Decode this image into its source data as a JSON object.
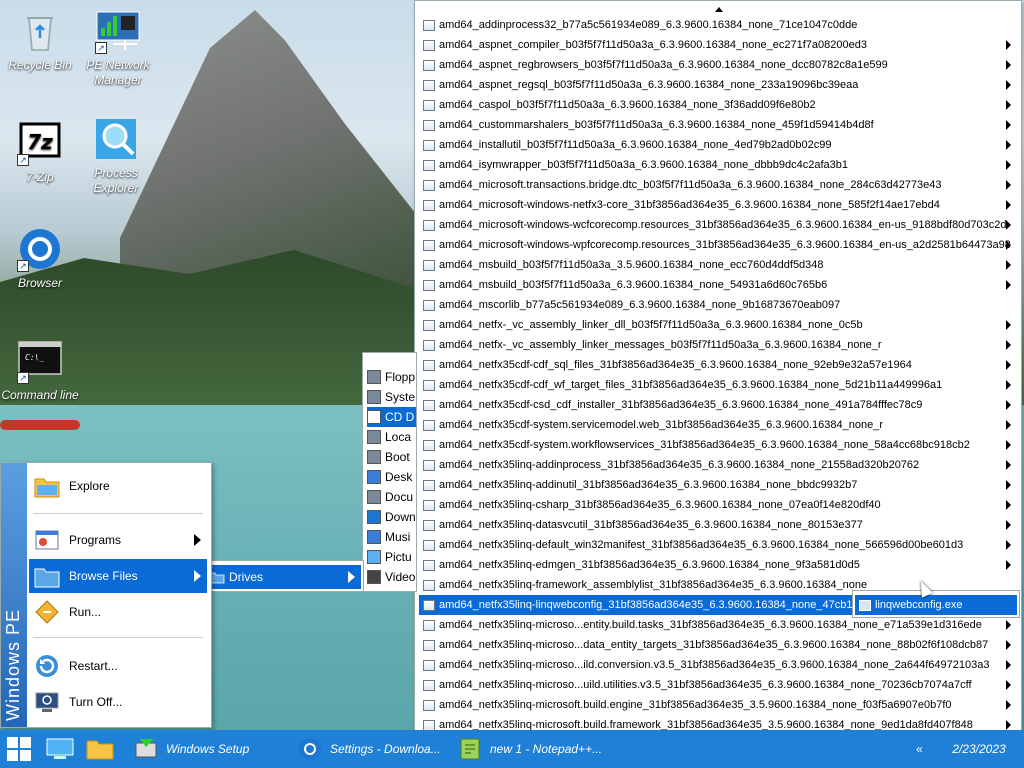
{
  "desktop": {
    "icons": [
      {
        "label": "Recycle Bin",
        "icon": "recycle-bin-icon"
      },
      {
        "label": "PE Network Manager",
        "icon": "network-manager-icon"
      },
      {
        "label": "7-Zip",
        "icon": "7zip-icon"
      },
      {
        "label": "Process Explorer",
        "icon": "process-explorer-icon"
      },
      {
        "label": "Browser",
        "icon": "browser-icon"
      },
      {
        "label": "Command line",
        "icon": "command-line-icon"
      }
    ]
  },
  "taskbar": {
    "buttons": [
      {
        "label": "Windows Setup"
      },
      {
        "label": "Settings - Downloa..."
      },
      {
        "label": "new 1 - Notepad++..."
      }
    ],
    "clock": "2/23/2023"
  },
  "start_menu": {
    "brand": "Windows PE",
    "items": [
      {
        "label": "Explore"
      },
      {
        "label": "Programs"
      },
      {
        "label": "Browse Files"
      },
      {
        "label": "Run..."
      },
      {
        "label": "Restart..."
      },
      {
        "label": "Turn Off..."
      }
    ]
  },
  "drives_menu": {
    "item": "Drives"
  },
  "drive_list": {
    "items": [
      "Flopp",
      "Syste",
      "CD D",
      "Loca",
      "Boot",
      "Desk",
      "Docu",
      "Down",
      "Musi",
      "Pictu",
      "Video"
    ]
  },
  "folder_list": {
    "rows": [
      "amd64_addinprocess32_b77a5c561934e089_6.3.9600.16384_none_71ce1047c0dde",
      "amd64_aspnet_compiler_b03f5f7f11d50a3a_6.3.9600.16384_none_ec271f7a08200ed3",
      "amd64_aspnet_regbrowsers_b03f5f7f11d50a3a_6.3.9600.16384_none_dcc80782c8a1e599",
      "amd64_aspnet_regsql_b03f5f7f11d50a3a_6.3.9600.16384_none_233a19096bc39eaa",
      "amd64_caspol_b03f5f7f11d50a3a_6.3.9600.16384_none_3f36add09f6e80b2",
      "amd64_custommarshalers_b03f5f7f11d50a3a_6.3.9600.16384_none_459f1d59414b4d8f",
      "amd64_installutil_b03f5f7f11d50a3a_6.3.9600.16384_none_4ed79b2ad0b02c99",
      "amd64_isymwrapper_b03f5f7f11d50a3a_6.3.9600.16384_none_dbbb9dc4c2afa3b1",
      "amd64_microsoft.transactions.bridge.dtc_b03f5f7f11d50a3a_6.3.9600.16384_none_284c63d42773e43",
      "amd64_microsoft-windows-netfx3-core_31bf3856ad364e35_6.3.9600.16384_none_585f2f14ae17ebd4",
      "amd64_microsoft-windows-wcfcorecomp.resources_31bf3856ad364e35_6.3.9600.16384_en-us_9188bdf80d703c2d",
      "amd64_microsoft-windows-wpfcorecomp.resources_31bf3856ad364e35_6.3.9600.16384_en-us_a2d2581b64473a98",
      "amd64_msbuild_b03f5f7f11d50a3a_3.5.9600.16384_none_ecc760d4ddf5d348",
      "amd64_msbuild_b03f5f7f11d50a3a_6.3.9600.16384_none_54931a6d60c765b6",
      "amd64_mscorlib_b77a5c561934e089_6.3.9600.16384_none_9b16873670eab097",
      "amd64_netfx-_vc_assembly_linker_dll_b03f5f7f11d50a3a_6.3.9600.16384_none_0c5b",
      "amd64_netfx-_vc_assembly_linker_messages_b03f5f7f11d50a3a_6.3.9600.16384_none_r",
      "amd64_netfx35cdf-cdf_sql_files_31bf3856ad364e35_6.3.9600.16384_none_92eb9e32a57e1964",
      "amd64_netfx35cdf-cdf_wf_target_files_31bf3856ad364e35_6.3.9600.16384_none_5d21b11a449996a1",
      "amd64_netfx35cdf-csd_cdf_installer_31bf3856ad364e35_6.3.9600.16384_none_491a784fffec78c9",
      "amd64_netfx35cdf-system.servicemodel.web_31bf3856ad364e35_6.3.9600.16384_none_r",
      "amd64_netfx35cdf-system.workflowservices_31bf3856ad364e35_6.3.9600.16384_none_58a4cc68bc918cb2",
      "amd64_netfx35linq-addinprocess_31bf3856ad364e35_6.3.9600.16384_none_21558ad320b20762",
      "amd64_netfx35linq-addinutil_31bf3856ad364e35_6.3.9600.16384_none_bbdc9932b7",
      "amd64_netfx35linq-csharp_31bf3856ad364e35_6.3.9600.16384_none_07ea0f14e820df40",
      "amd64_netfx35linq-datasvcutil_31bf3856ad364e35_6.3.9600.16384_none_80153e377",
      "amd64_netfx35linq-default_win32manifest_31bf3856ad364e35_6.3.9600.16384_none_566596d00be601d3",
      "amd64_netfx35linq-edmgen_31bf3856ad364e35_6.3.9600.16384_none_9f3a581d0d5",
      "amd64_netfx35linq-framework_assemblylist_31bf3856ad364e35_6.3.9600.16384_none",
      "amd64_netfx35linq-linqwebconfig_31bf3856ad364e35_6.3.9600.16384_none_47cb15",
      "amd64_netfx35linq-microso...entity.build.tasks_31bf3856ad364e35_6.3.9600.16384_none_e71a539e1d316ede",
      "amd64_netfx35linq-microso...data_entity_targets_31bf3856ad364e35_6.3.9600.16384_none_88b02f6f108dcb87",
      "amd64_netfx35linq-microso...ild.conversion.v3.5_31bf3856ad364e35_6.3.9600.16384_none_2a644f64972103a3",
      "amd64_netfx35linq-microso...uild.utilities.v3.5_31bf3856ad364e35_6.3.9600.16384_none_70236cb7074a7cff",
      "amd64_netfx35linq-microsoft.build.engine_31bf3856ad364e35_3.5.9600.16384_none_f03f5a6907e0b7f0",
      "amd64_netfx35linq-microsoft.build.framework_31bf3856ad364e35_3.5.9600.16384_none_9ed1da8fd407f848"
    ],
    "selected_index": 29
  },
  "exe_menu": {
    "item": "linqwebconfig.exe"
  },
  "colors": {
    "accent": "#0a6ad6",
    "taskbar": "#1f80d8"
  }
}
